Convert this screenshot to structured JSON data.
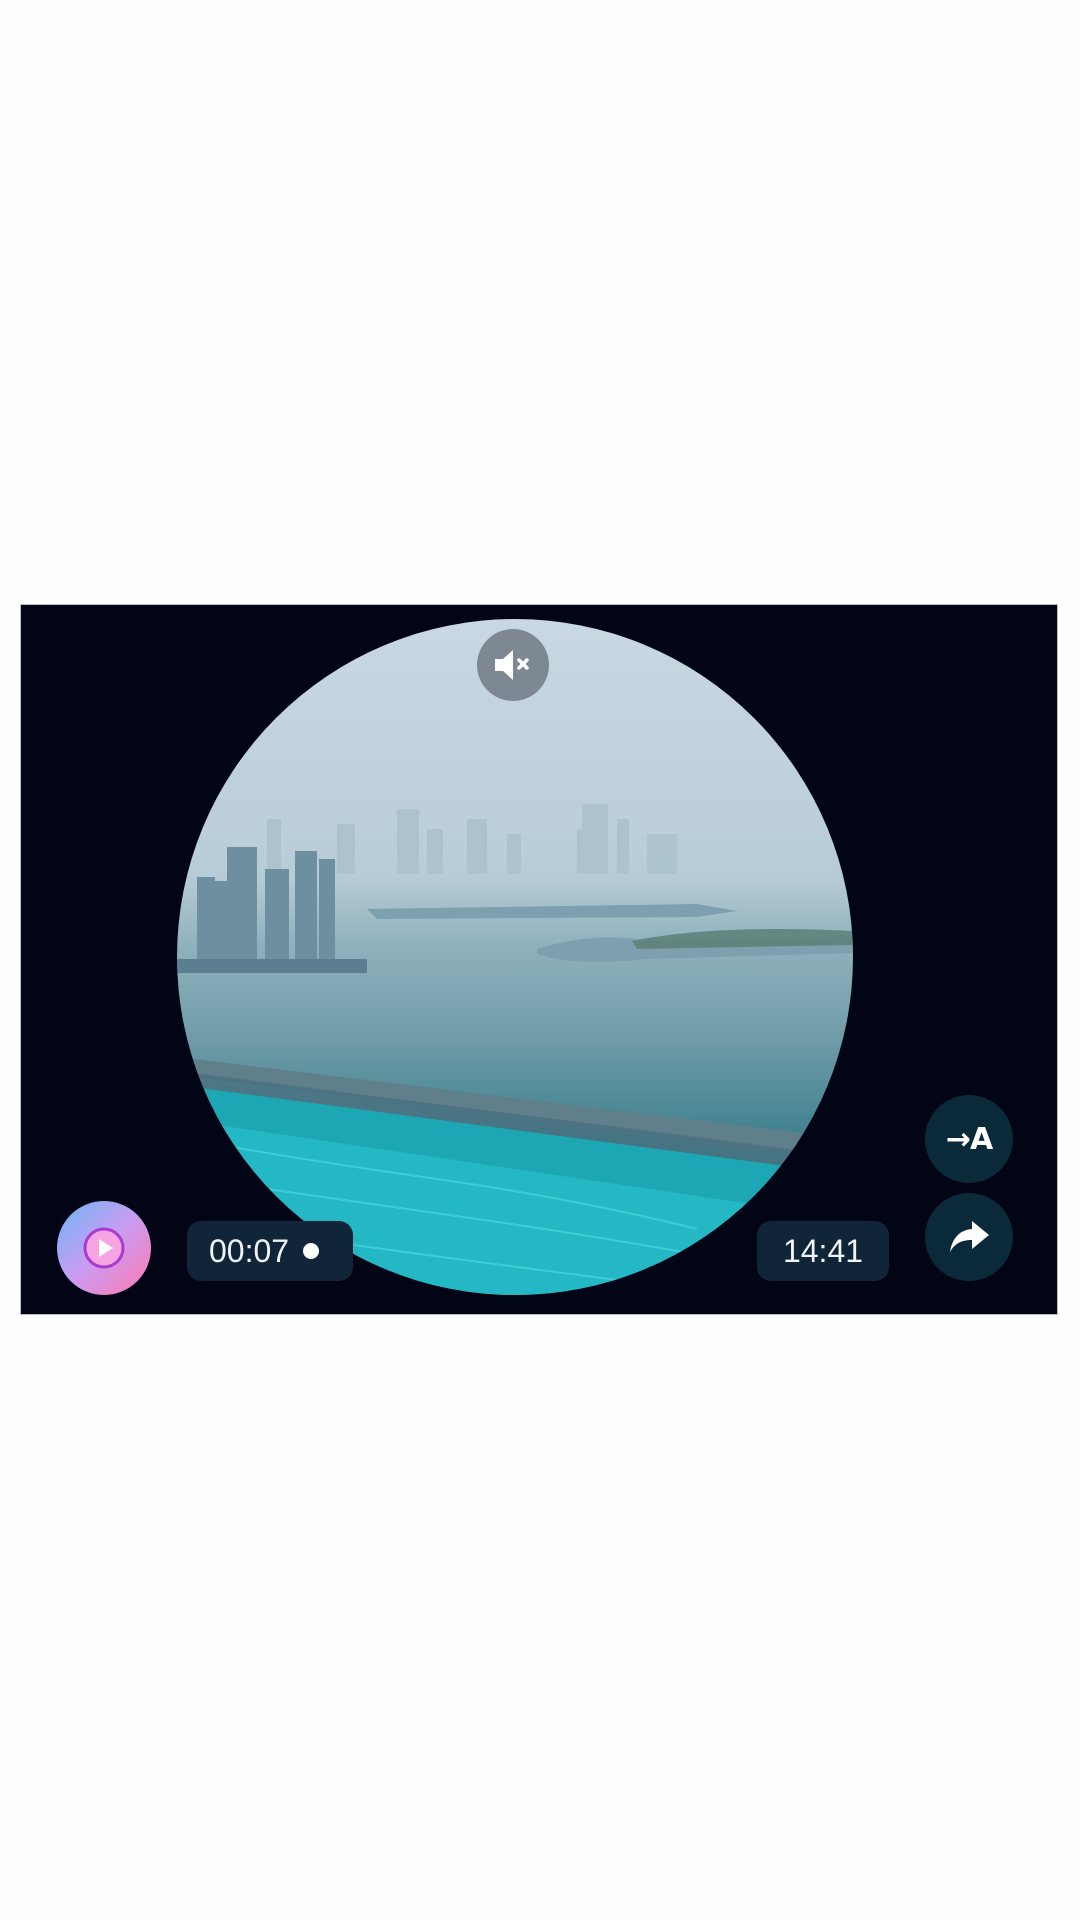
{
  "video_message": {
    "duration": "00:07",
    "sent_time": "14:41",
    "muted": true,
    "icons": {
      "mute": "speaker-muted-icon",
      "play": "play-icon",
      "translate": "translate-icon",
      "share": "share-icon"
    },
    "translate_glyph": "→A"
  },
  "colors": {
    "frame_background": "#010515",
    "pill_background": "#102538",
    "side_button_background": "#0a2a3a",
    "play_gradient_start": "#6ab7f3",
    "play_gradient_end": "#ff79b1"
  }
}
